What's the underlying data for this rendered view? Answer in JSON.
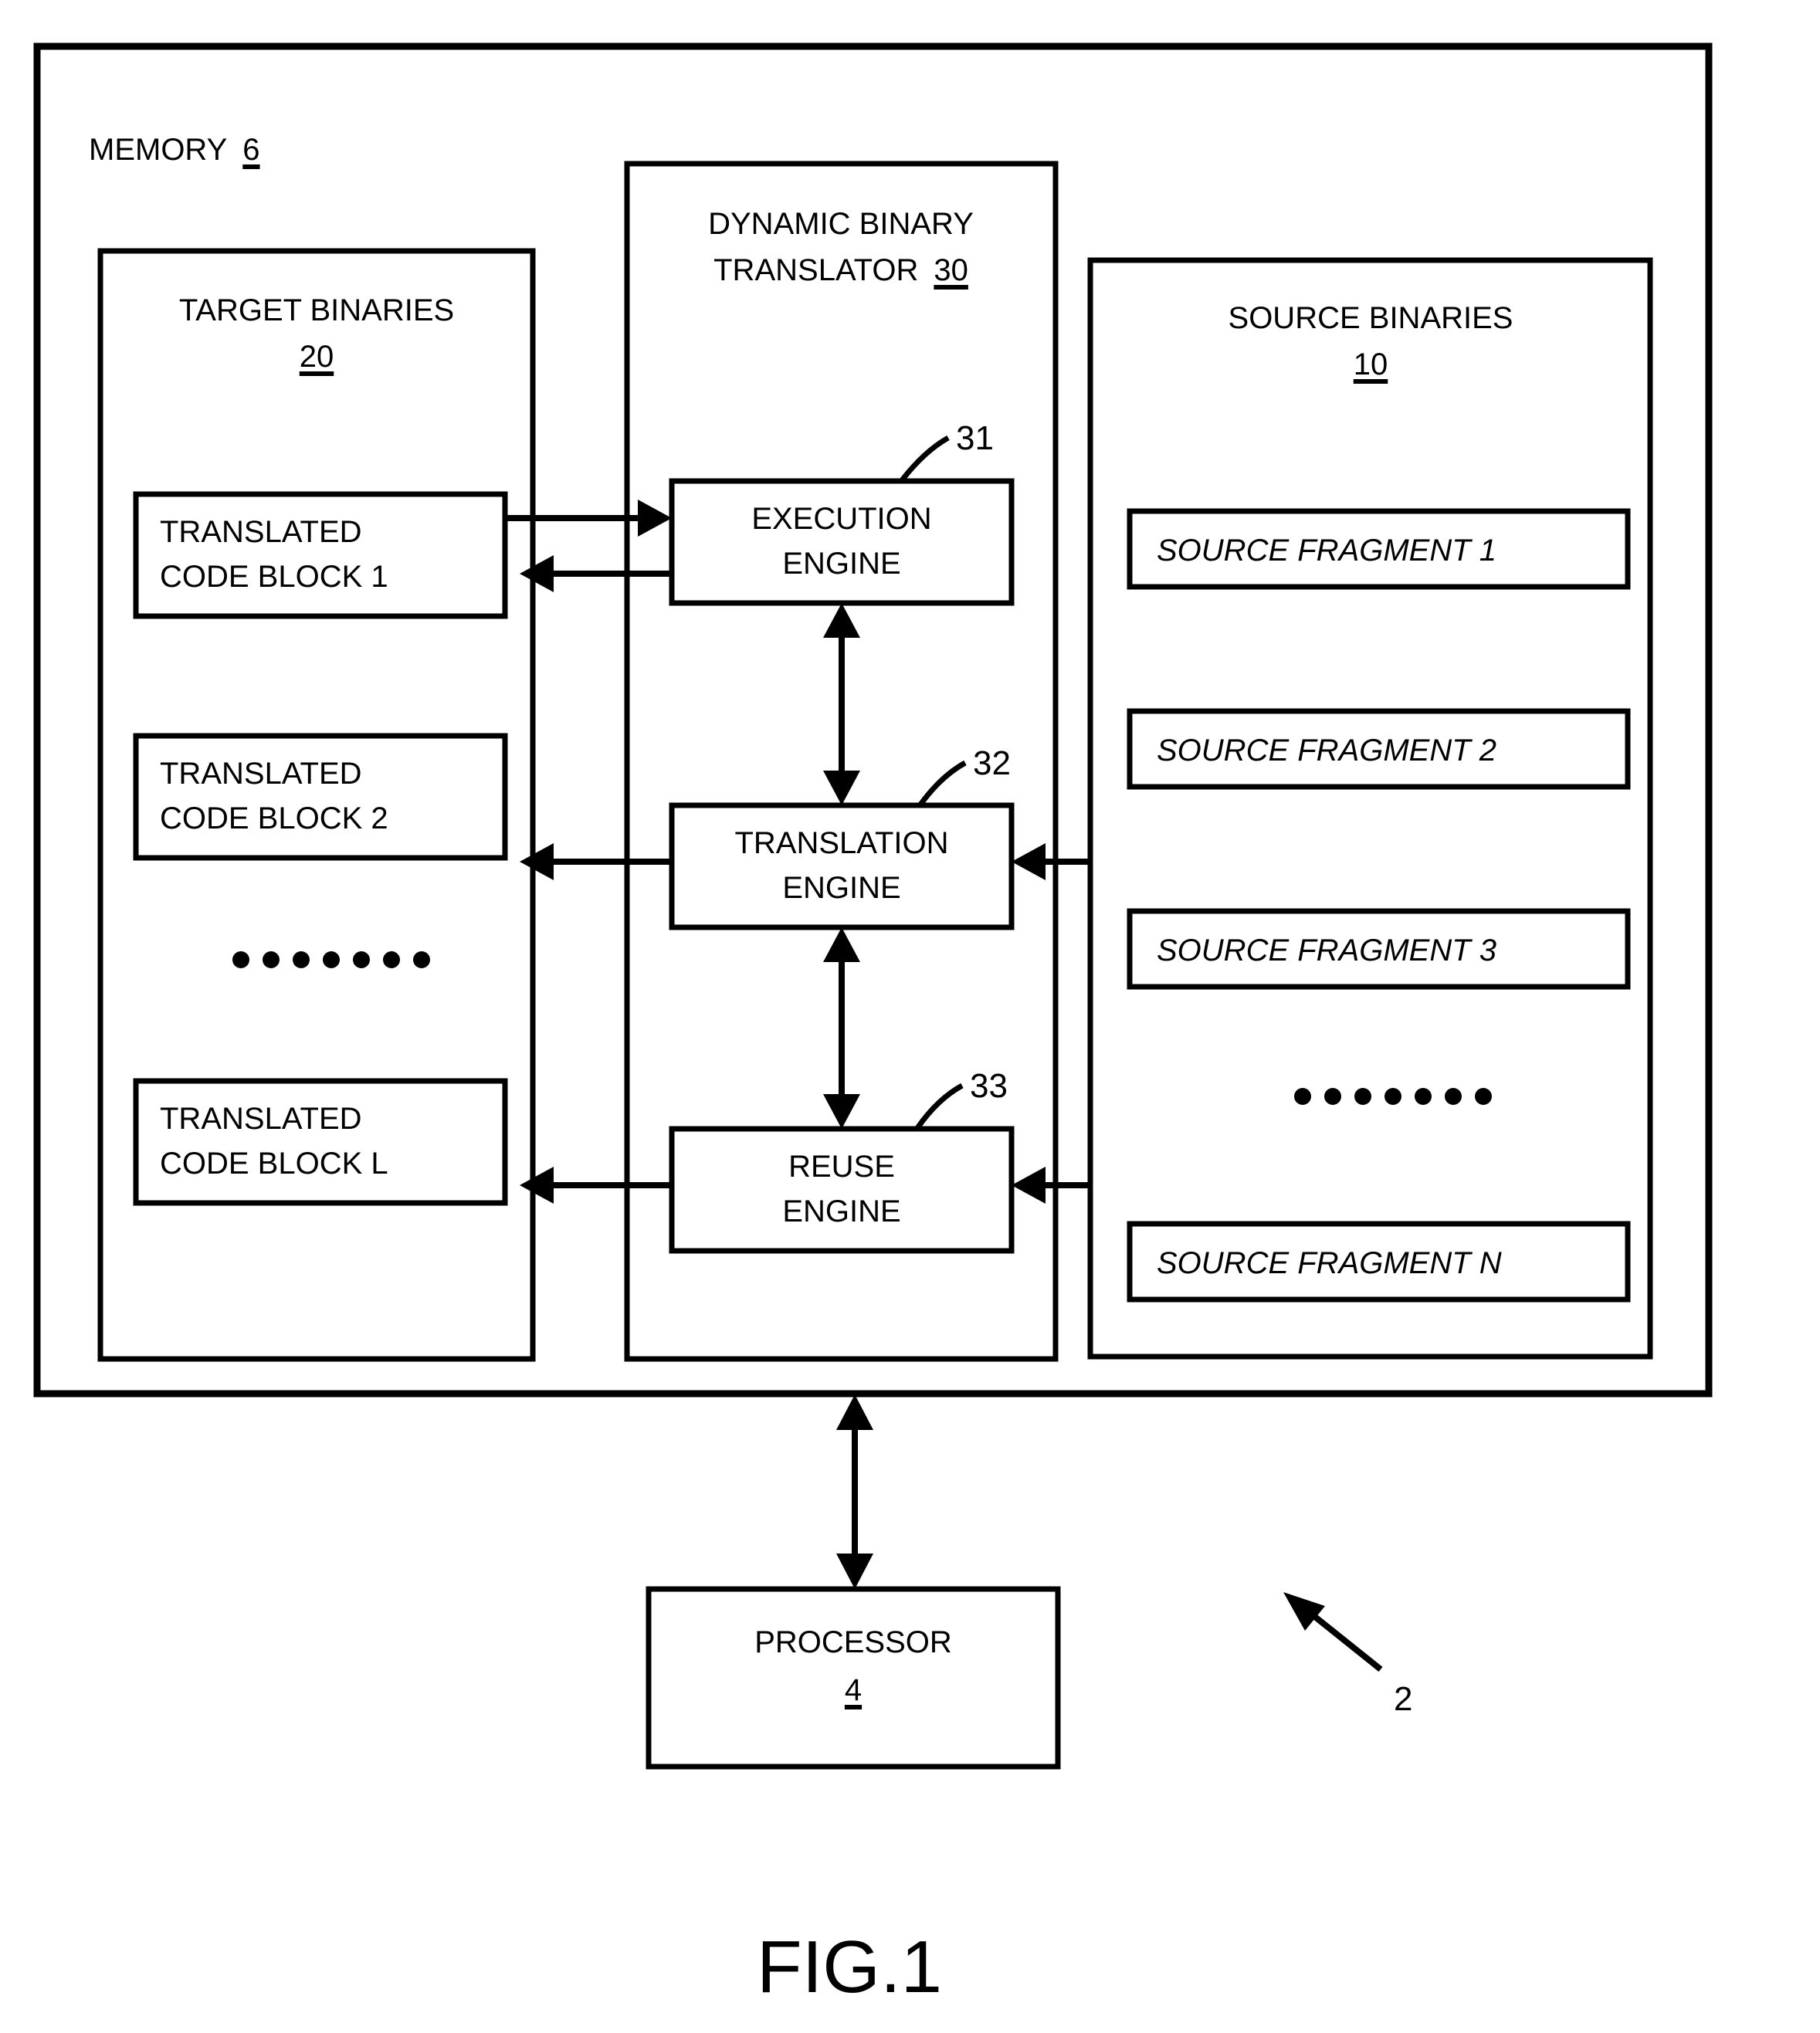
{
  "figure": {
    "caption": "FIG.1",
    "system_ref": "2"
  },
  "memory": {
    "title": "MEMORY",
    "ref": "6"
  },
  "target_binaries": {
    "title": "TARGET BINARIES",
    "ref": "20",
    "blocks": [
      {
        "line1": "TRANSLATED",
        "line2": "CODE BLOCK 1"
      },
      {
        "line1": "TRANSLATED",
        "line2": "CODE BLOCK 2"
      },
      {
        "line1": "TRANSLATED",
        "line2": "CODE BLOCK L"
      }
    ],
    "ellipsis": ". . . . . . ."
  },
  "translator": {
    "title_line1": "DYNAMIC BINARY",
    "title_line2": "TRANSLATOR",
    "ref": "30",
    "engines": [
      {
        "line1": "EXECUTION",
        "line2": "ENGINE",
        "ref": "31"
      },
      {
        "line1": "TRANSLATION",
        "line2": "ENGINE",
        "ref": "32"
      },
      {
        "line1": "REUSE",
        "line2": "ENGINE",
        "ref": "33"
      }
    ]
  },
  "source_binaries": {
    "title": "SOURCE BINARIES",
    "ref": "10",
    "fragments": [
      {
        "label": "SOURCE FRAGMENT 1"
      },
      {
        "label": "SOURCE FRAGMENT 2"
      },
      {
        "label": "SOURCE FRAGMENT 3"
      },
      {
        "label": "SOURCE FRAGMENT N"
      }
    ],
    "ellipsis": ". . . . . . ."
  },
  "processor": {
    "title": "PROCESSOR",
    "ref": "4"
  },
  "colors": {
    "ink": "#000000",
    "paper": "#ffffff"
  }
}
